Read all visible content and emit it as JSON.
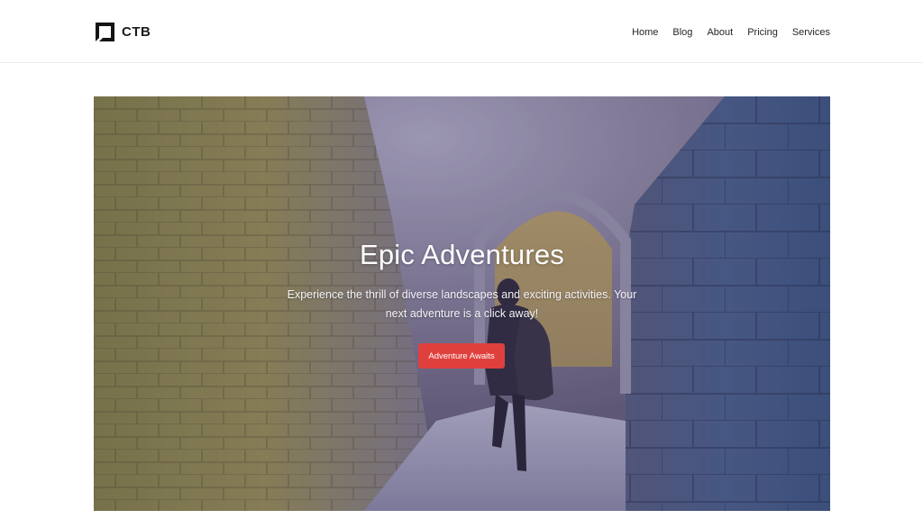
{
  "header": {
    "logo_text": "CTB",
    "nav": [
      {
        "label": "Home"
      },
      {
        "label": "Blog"
      },
      {
        "label": "About"
      },
      {
        "label": "Pricing"
      },
      {
        "label": "Services"
      }
    ]
  },
  "hero": {
    "title": "Epic Adventures",
    "subtitle": "Experience the thrill of diverse landscapes and exciting activities. Your next adventure is a click away!",
    "button_label": "Adventure Awaits",
    "button_color": "#e0403d",
    "background_image": "stone-tunnel-with-hiker-photo"
  }
}
